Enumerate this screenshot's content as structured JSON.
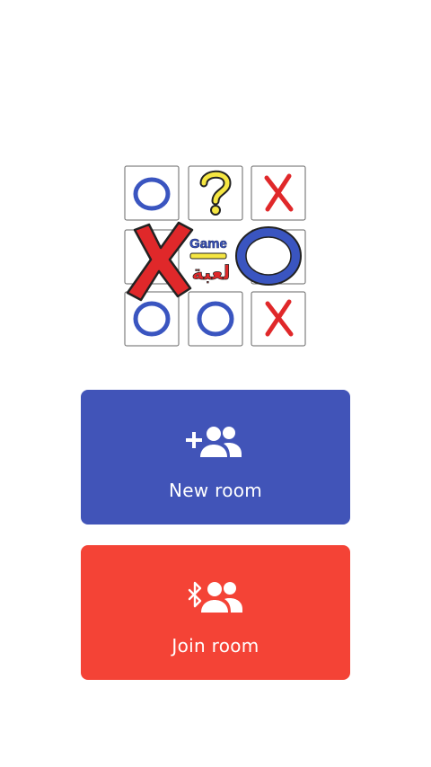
{
  "colors": {
    "new_room": "#4154b8",
    "join_room": "#f44336",
    "o_blue": "#3a55c0",
    "x_red": "#e0282a",
    "question_yellow": "#f5e642"
  },
  "logo": {
    "board": [
      [
        "O",
        "?",
        "X"
      ],
      [
        "X",
        "",
        "O"
      ],
      [
        "O",
        "O",
        "X"
      ]
    ],
    "badge_text_en": "Game",
    "badge_text_ar": "لعبة"
  },
  "buttons": {
    "new_room": {
      "label": "New room",
      "icon": "group-add-icon",
      "color": "#4154b8"
    },
    "join_room": {
      "label": "Join room",
      "icon": "bluetooth-group-icon",
      "color": "#f44336"
    }
  }
}
